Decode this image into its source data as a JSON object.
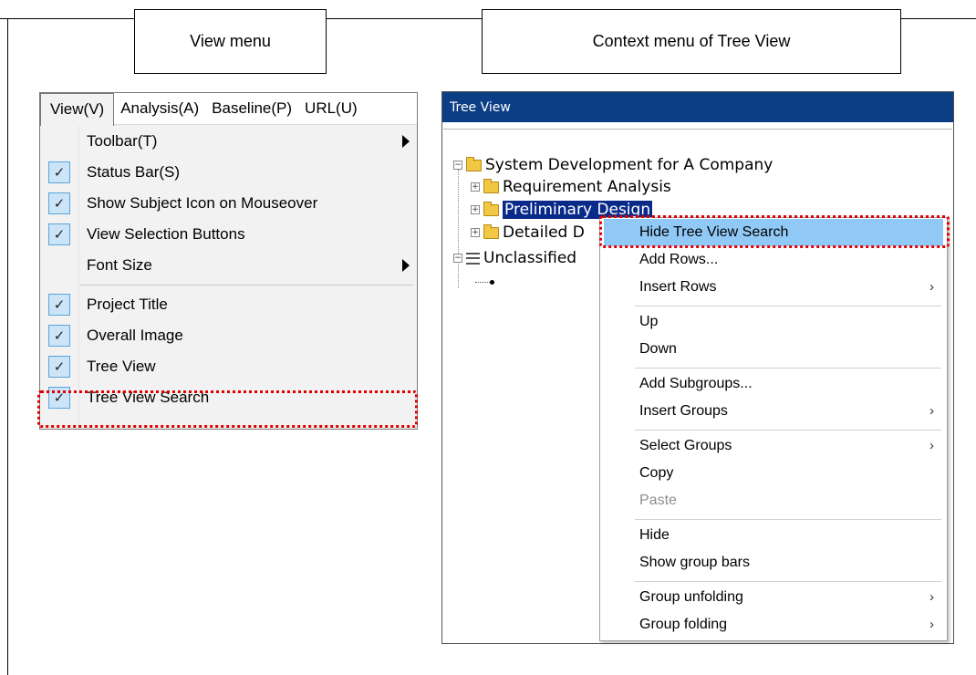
{
  "captions": {
    "view_menu": "View menu",
    "context_menu": "Context menu of Tree View"
  },
  "menubar": [
    "View(V)",
    "Analysis(A)",
    "Baseline(P)",
    "URL(U)"
  ],
  "view_menu": {
    "items": [
      {
        "label": "Toolbar(T)",
        "checked": false,
        "submenu": true
      },
      {
        "label": "Status Bar(S)",
        "checked": true,
        "submenu": false
      },
      {
        "label": "Show Subject Icon on Mouseover",
        "checked": true,
        "submenu": false
      },
      {
        "label": "View Selection Buttons",
        "checked": true,
        "submenu": false
      },
      {
        "label": "Font Size",
        "checked": false,
        "submenu": true
      },
      {
        "label": "Project Title",
        "checked": true,
        "submenu": false
      },
      {
        "label": "Overall Image",
        "checked": true,
        "submenu": false
      },
      {
        "label": "Tree View",
        "checked": true,
        "submenu": false
      },
      {
        "label": "Tree View Search",
        "checked": true,
        "submenu": false
      }
    ],
    "check_glyph": "✓"
  },
  "tree_view": {
    "title": "Tree View",
    "root": "System Development for A Company",
    "children": [
      "Requirement Analysis",
      "Preliminary Design",
      "Detailed D"
    ],
    "unclassified": "Unclassified",
    "expand_glyph": "+",
    "collapse_glyph": "−"
  },
  "context_menu": {
    "items": [
      {
        "label": "Hide Tree View Search",
        "submenu": false,
        "disabled": false
      },
      {
        "label": "Add Rows...",
        "submenu": false,
        "disabled": false
      },
      {
        "label": "Insert Rows",
        "submenu": true,
        "disabled": false
      },
      {
        "label": "Up",
        "submenu": false,
        "disabled": false
      },
      {
        "label": "Down",
        "submenu": false,
        "disabled": false
      },
      {
        "label": "Add Subgroups...",
        "submenu": false,
        "disabled": false
      },
      {
        "label": "Insert Groups",
        "submenu": true,
        "disabled": false
      },
      {
        "label": "Select Groups",
        "submenu": true,
        "disabled": false
      },
      {
        "label": "Copy",
        "submenu": false,
        "disabled": false
      },
      {
        "label": "Paste",
        "submenu": false,
        "disabled": true
      },
      {
        "label": "Hide",
        "submenu": false,
        "disabled": false
      },
      {
        "label": "Show group bars",
        "submenu": false,
        "disabled": false
      },
      {
        "label": "Group unfolding",
        "submenu": true,
        "disabled": false
      },
      {
        "label": "Group folding",
        "submenu": true,
        "disabled": false
      }
    ],
    "chevron_glyph": "›"
  },
  "colors": {
    "highlight": "#90c8f6",
    "selection": "#0a2a8a",
    "title_bar": "#0c3e86",
    "callout": "#e00000"
  }
}
